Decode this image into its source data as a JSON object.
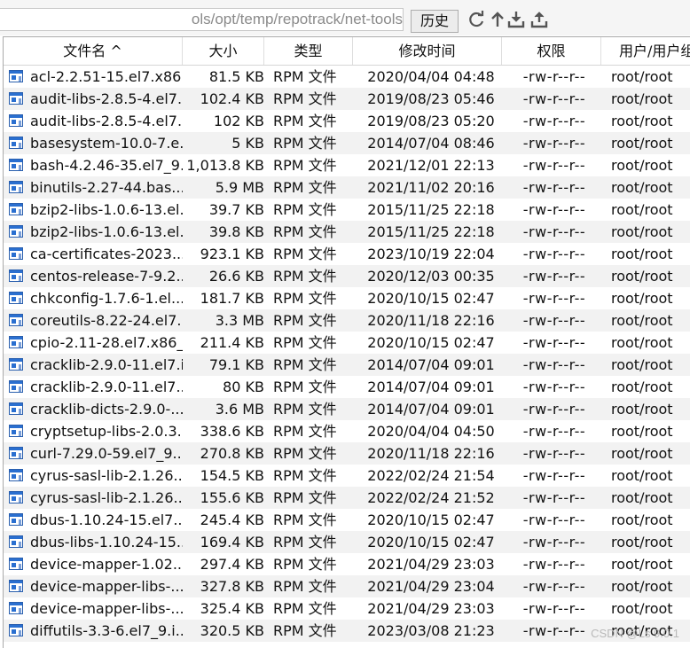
{
  "toolbar": {
    "path": "ols/opt/temp/repotrack/net-tools",
    "history_label": "历史",
    "icons": [
      "refresh-icon",
      "up-icon",
      "download-icon",
      "upload-icon"
    ]
  },
  "columns": [
    "文件名 ^",
    "大小",
    "类型",
    "修改时间",
    "权限",
    "用户/用户组"
  ],
  "files": [
    {
      "name": "acl-2.2.51-15.el7.x86...",
      "size": "81.5 KB",
      "type": "RPM 文件",
      "date": "2020/04/04 04:48",
      "perm": "-rw-r--r--",
      "owner": "root/root"
    },
    {
      "name": "audit-libs-2.8.5-4.el7...",
      "size": "102.4 KB",
      "type": "RPM 文件",
      "date": "2019/08/23 05:46",
      "perm": "-rw-r--r--",
      "owner": "root/root"
    },
    {
      "name": "audit-libs-2.8.5-4.el7...",
      "size": "102 KB",
      "type": "RPM 文件",
      "date": "2019/08/23 05:20",
      "perm": "-rw-r--r--",
      "owner": "root/root"
    },
    {
      "name": "basesystem-10.0-7.e...",
      "size": "5 KB",
      "type": "RPM 文件",
      "date": "2014/07/04 08:46",
      "perm": "-rw-r--r--",
      "owner": "root/root"
    },
    {
      "name": "bash-4.2.46-35.el7_9...",
      "size": "1,013.8 KB",
      "type": "RPM 文件",
      "date": "2021/12/01 22:13",
      "perm": "-rw-r--r--",
      "owner": "root/root"
    },
    {
      "name": "binutils-2.27-44.bas...",
      "size": "5.9 MB",
      "type": "RPM 文件",
      "date": "2021/11/02 20:16",
      "perm": "-rw-r--r--",
      "owner": "root/root"
    },
    {
      "name": "bzip2-libs-1.0.6-13.el...",
      "size": "39.7 KB",
      "type": "RPM 文件",
      "date": "2015/11/25 22:18",
      "perm": "-rw-r--r--",
      "owner": "root/root"
    },
    {
      "name": "bzip2-libs-1.0.6-13.el...",
      "size": "39.8 KB",
      "type": "RPM 文件",
      "date": "2015/11/25 22:18",
      "perm": "-rw-r--r--",
      "owner": "root/root"
    },
    {
      "name": "ca-certificates-2023...",
      "size": "923.1 KB",
      "type": "RPM 文件",
      "date": "2023/10/19 22:04",
      "perm": "-rw-r--r--",
      "owner": "root/root"
    },
    {
      "name": "centos-release-7-9.2...",
      "size": "26.6 KB",
      "type": "RPM 文件",
      "date": "2020/12/03 00:35",
      "perm": "-rw-r--r--",
      "owner": "root/root"
    },
    {
      "name": "chkconfig-1.7.6-1.el...",
      "size": "181.7 KB",
      "type": "RPM 文件",
      "date": "2020/10/15 02:47",
      "perm": "-rw-r--r--",
      "owner": "root/root"
    },
    {
      "name": "coreutils-8.22-24.el7...",
      "size": "3.3 MB",
      "type": "RPM 文件",
      "date": "2020/11/18 22:16",
      "perm": "-rw-r--r--",
      "owner": "root/root"
    },
    {
      "name": "cpio-2.11-28.el7.x86_...",
      "size": "211.4 KB",
      "type": "RPM 文件",
      "date": "2020/10/15 02:47",
      "perm": "-rw-r--r--",
      "owner": "root/root"
    },
    {
      "name": "cracklib-2.9.0-11.el7.i...",
      "size": "79.1 KB",
      "type": "RPM 文件",
      "date": "2014/07/04 09:01",
      "perm": "-rw-r--r--",
      "owner": "root/root"
    },
    {
      "name": "cracklib-2.9.0-11.el7...",
      "size": "80 KB",
      "type": "RPM 文件",
      "date": "2014/07/04 09:01",
      "perm": "-rw-r--r--",
      "owner": "root/root"
    },
    {
      "name": "cracklib-dicts-2.9.0-...",
      "size": "3.6 MB",
      "type": "RPM 文件",
      "date": "2014/07/04 09:01",
      "perm": "-rw-r--r--",
      "owner": "root/root"
    },
    {
      "name": "cryptsetup-libs-2.0.3...",
      "size": "338.6 KB",
      "type": "RPM 文件",
      "date": "2020/04/04 04:50",
      "perm": "-rw-r--r--",
      "owner": "root/root"
    },
    {
      "name": "curl-7.29.0-59.el7_9....",
      "size": "270.8 KB",
      "type": "RPM 文件",
      "date": "2020/11/18 22:16",
      "perm": "-rw-r--r--",
      "owner": "root/root"
    },
    {
      "name": "cyrus-sasl-lib-2.1.26...",
      "size": "154.5 KB",
      "type": "RPM 文件",
      "date": "2022/02/24 21:54",
      "perm": "-rw-r--r--",
      "owner": "root/root"
    },
    {
      "name": "cyrus-sasl-lib-2.1.26...",
      "size": "155.6 KB",
      "type": "RPM 文件",
      "date": "2022/02/24 21:52",
      "perm": "-rw-r--r--",
      "owner": "root/root"
    },
    {
      "name": "dbus-1.10.24-15.el7...",
      "size": "245.4 KB",
      "type": "RPM 文件",
      "date": "2020/10/15 02:47",
      "perm": "-rw-r--r--",
      "owner": "root/root"
    },
    {
      "name": "dbus-libs-1.10.24-15...",
      "size": "169.4 KB",
      "type": "RPM 文件",
      "date": "2020/10/15 02:47",
      "perm": "-rw-r--r--",
      "owner": "root/root"
    },
    {
      "name": "device-mapper-1.02....",
      "size": "297.4 KB",
      "type": "RPM 文件",
      "date": "2021/04/29 23:03",
      "perm": "-rw-r--r--",
      "owner": "root/root"
    },
    {
      "name": "device-mapper-libs-...",
      "size": "327.8 KB",
      "type": "RPM 文件",
      "date": "2021/04/29 23:04",
      "perm": "-rw-r--r--",
      "owner": "root/root"
    },
    {
      "name": "device-mapper-libs-...",
      "size": "325.4 KB",
      "type": "RPM 文件",
      "date": "2021/04/29 23:03",
      "perm": "-rw-r--r--",
      "owner": "root/root"
    },
    {
      "name": "diffutils-3.3-6.el7_9.i...",
      "size": "320.5 KB",
      "type": "RPM 文件",
      "date": "2023/03/08 21:23",
      "perm": "-rw-r--r--",
      "owner": "root/root"
    }
  ],
  "watermark": "CSDN @Ls 9.0.1"
}
